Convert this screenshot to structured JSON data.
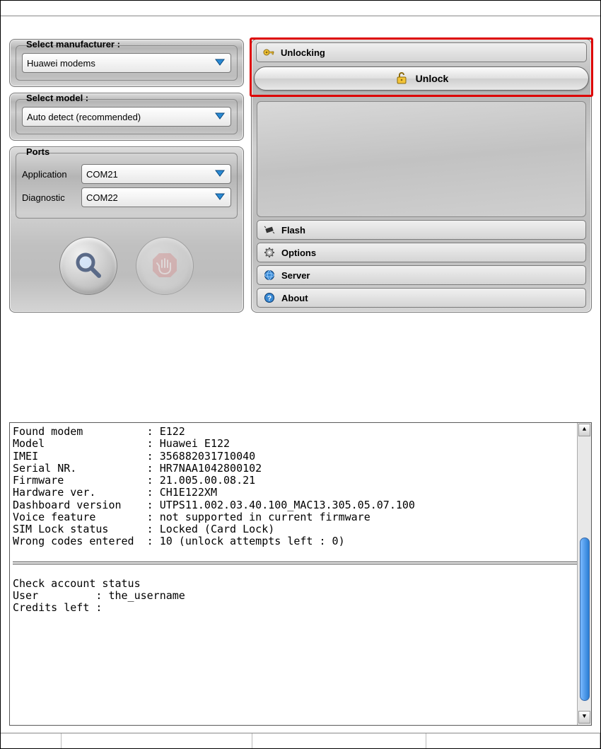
{
  "manufacturer": {
    "legend": "Select manufacturer :",
    "value": "Huawei modems"
  },
  "model": {
    "legend": "Select model :",
    "value": "Auto detect (recommended)"
  },
  "ports": {
    "legend": "Ports",
    "application": {
      "label": "Application",
      "value": "COM21"
    },
    "diagnostic": {
      "label": "Diagnostic",
      "value": "COM22"
    }
  },
  "accordion": {
    "unlocking": {
      "label": "Unlocking",
      "button": "Unlock"
    },
    "flash": "Flash",
    "options": "Options",
    "server": "Server",
    "about": "About"
  },
  "log": "Found modem          : E122\nModel                : Huawei E122\nIMEI                 : 356882031710040\nSerial NR.           : HR7NAA1042800102\nFirmware             : 21.005.00.08.21\nHardware ver.        : CH1E122XM\nDashboard version    : UTPS11.002.03.40.100_MAC13.305.05.07.100\nVoice feature        : not supported in current firmware\nSIM Lock status      : Locked (Card Lock)\nWrong codes entered  : 10 (unlock attempts left : 0)",
  "log2": "Check account status\nUser         : the_username\nCredits left :"
}
